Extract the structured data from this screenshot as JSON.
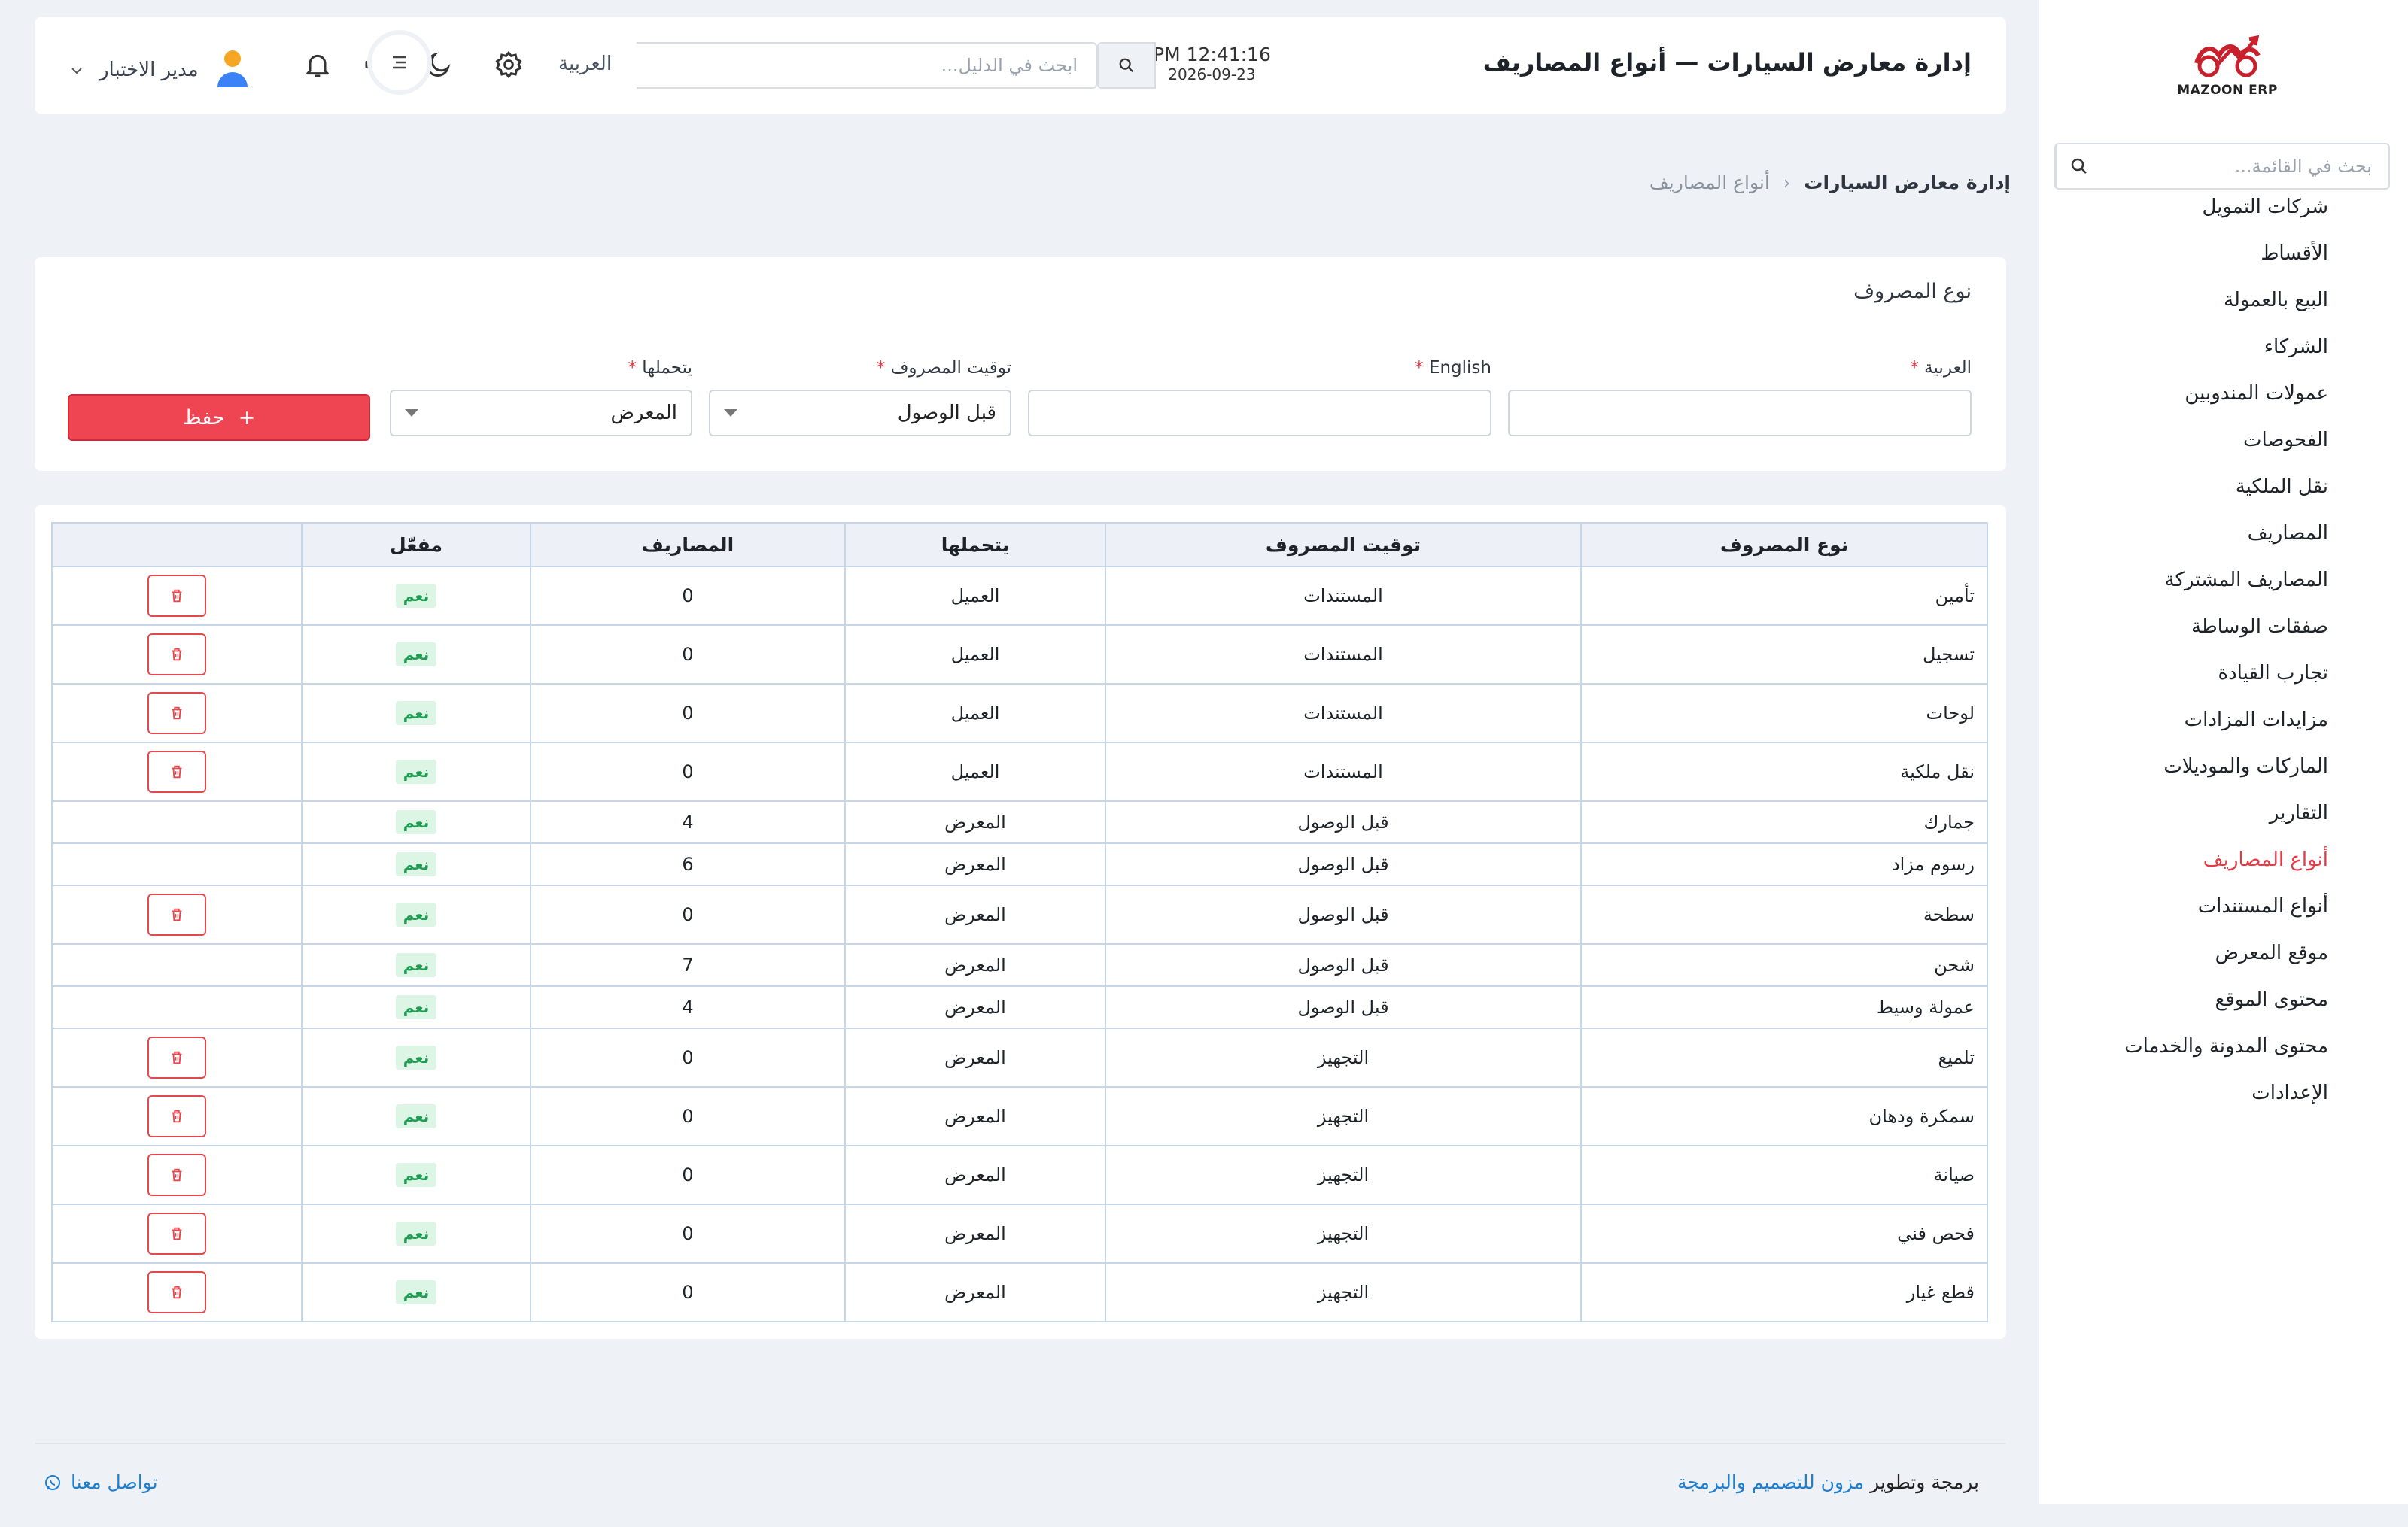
{
  "sidebar": {
    "logo_text": "MAZOON ERP",
    "search_placeholder": "بحث في القائمة...",
    "items": [
      {
        "label": "شركات التمويل"
      },
      {
        "label": "الأقساط"
      },
      {
        "label": "البيع بالعمولة"
      },
      {
        "label": "الشركاء"
      },
      {
        "label": "عمولات المندوبين"
      },
      {
        "label": "الفحوصات"
      },
      {
        "label": "نقل الملكية"
      },
      {
        "label": "المصاريف"
      },
      {
        "label": "المصاريف المشتركة"
      },
      {
        "label": "صفقات الوساطة"
      },
      {
        "label": "تجارب القيادة"
      },
      {
        "label": "مزايدات المزادات"
      },
      {
        "label": "الماركات والموديلات"
      },
      {
        "label": "التقارير"
      },
      {
        "label": "أنواع المصاريف",
        "active": true
      },
      {
        "label": "أنواع المستندات"
      },
      {
        "label": "موقع المعرض"
      },
      {
        "label": "محتوى الموقع"
      },
      {
        "label": "محتوى المدونة والخدمات"
      },
      {
        "label": "الإعدادات"
      }
    ]
  },
  "header": {
    "title": "إدارة معارض السيارات — أنواع المصاريف",
    "time": "PM 12:41:16",
    "date": "2026-09-23",
    "search_placeholder": "ابحث في الدليل...",
    "language": "العربية",
    "user_name": "مدير الاختبار"
  },
  "breadcrumb": {
    "root": "إدارة معارض السيارات",
    "current": "أنواع المصاريف"
  },
  "form": {
    "title": "نوع المصروف",
    "arabic_label": "العربية",
    "english_label": "English",
    "timing_label": "توقيت المصروف",
    "timing_value": "قبل الوصول",
    "bearer_label": "يتحملها",
    "bearer_value": "المعرض",
    "save_label": "حفظ"
  },
  "table": {
    "headers": [
      "نوع المصروف",
      "توقيت المصروف",
      "يتحملها",
      "المصاريف",
      "مفعّل",
      ""
    ],
    "rows": [
      {
        "name": "تأمين",
        "timing": "المستندات",
        "bearer": "العميل",
        "count": "0",
        "enabled": "نعم",
        "deletable": true
      },
      {
        "name": "تسجيل",
        "timing": "المستندات",
        "bearer": "العميل",
        "count": "0",
        "enabled": "نعم",
        "deletable": true
      },
      {
        "name": "لوحات",
        "timing": "المستندات",
        "bearer": "العميل",
        "count": "0",
        "enabled": "نعم",
        "deletable": true
      },
      {
        "name": "نقل ملكية",
        "timing": "المستندات",
        "bearer": "العميل",
        "count": "0",
        "enabled": "نعم",
        "deletable": true
      },
      {
        "name": "جمارك",
        "timing": "قبل الوصول",
        "bearer": "المعرض",
        "count": "4",
        "enabled": "نعم",
        "deletable": false
      },
      {
        "name": "رسوم مزاد",
        "timing": "قبل الوصول",
        "bearer": "المعرض",
        "count": "6",
        "enabled": "نعم",
        "deletable": false
      },
      {
        "name": "سطحة",
        "timing": "قبل الوصول",
        "bearer": "المعرض",
        "count": "0",
        "enabled": "نعم",
        "deletable": true
      },
      {
        "name": "شحن",
        "timing": "قبل الوصول",
        "bearer": "المعرض",
        "count": "7",
        "enabled": "نعم",
        "deletable": false
      },
      {
        "name": "عمولة وسيط",
        "timing": "قبل الوصول",
        "bearer": "المعرض",
        "count": "4",
        "enabled": "نعم",
        "deletable": false
      },
      {
        "name": "تلميع",
        "timing": "التجهيز",
        "bearer": "المعرض",
        "count": "0",
        "enabled": "نعم",
        "deletable": true
      },
      {
        "name": "سمكرة ودهان",
        "timing": "التجهيز",
        "bearer": "المعرض",
        "count": "0",
        "enabled": "نعم",
        "deletable": true
      },
      {
        "name": "صيانة",
        "timing": "التجهيز",
        "bearer": "المعرض",
        "count": "0",
        "enabled": "نعم",
        "deletable": true
      },
      {
        "name": "فحص فني",
        "timing": "التجهيز",
        "bearer": "المعرض",
        "count": "0",
        "enabled": "نعم",
        "deletable": true
      },
      {
        "name": "قطع غيار",
        "timing": "التجهيز",
        "bearer": "المعرض",
        "count": "0",
        "enabled": "نعم",
        "deletable": true
      }
    ]
  },
  "footer": {
    "credit_prefix": "برمجة وتطوير",
    "credit_brand": "مزون للتصميم والبرمجة",
    "contact": "تواصل معنا"
  },
  "colors": {
    "accent": "#ef4452",
    "active_menu": "#e53945",
    "badge_bg": "#dcf5e5",
    "badge_text": "#1f9e53",
    "link": "#1e7fd1"
  }
}
